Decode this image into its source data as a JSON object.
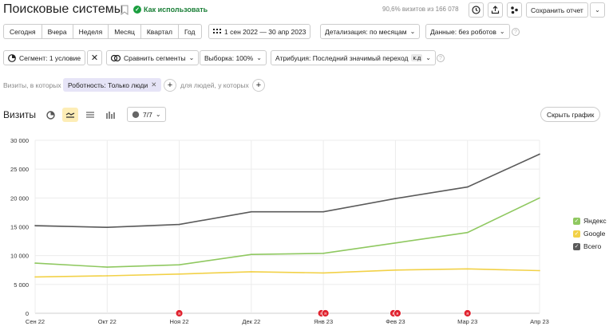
{
  "header": {
    "title": "Поисковые системы",
    "how_to_use": "Как использовать",
    "share_text": "90,6% визитов из 166 078",
    "save_report": "Сохранить отчет"
  },
  "toolbar": {
    "periods": [
      "Сегодня",
      "Вчера",
      "Неделя",
      "Месяц",
      "Квартал",
      "Год"
    ],
    "date_range": "1 сен 2022 — 30 апр 2023",
    "detail": "Детализация: по месяцам",
    "data": "Данные: без роботов"
  },
  "filters": {
    "segment": "Сегмент: 1 условие",
    "compare": "Сравнить сегменты",
    "sample": "Выборка: 100%",
    "attribution": "Атрибуция: Последний значимый переход",
    "attribution_badge": "к.д"
  },
  "conditions": {
    "visits_label": "Визиты, в которых",
    "chip": "Роботность: Только люди",
    "people_label": "для людей, у которых"
  },
  "chart_header": {
    "metric": "Визиты",
    "series_count": "7/7",
    "hide_chart": "Скрыть график"
  },
  "colors": {
    "yandex": "#8fc860",
    "google": "#f2d147",
    "total": "#5a5a5a",
    "marker": "#e0232f"
  },
  "chart_data": {
    "type": "line",
    "categories": [
      "Сен 22",
      "Окт 22",
      "Ноя 22",
      "Дек 22",
      "Янв 23",
      "Фев 23",
      "Мар 23",
      "Апр 23"
    ],
    "ylim": [
      0,
      30000
    ],
    "yticks": [
      "0",
      "5 000",
      "10 000",
      "15 000",
      "20 000",
      "25 000",
      "30 000"
    ],
    "grid": true,
    "legend": "right",
    "series": [
      {
        "name": "Яндекс",
        "color": "#8fc860",
        "values": [
          8700,
          8000,
          8400,
          10200,
          10400,
          12200,
          14000,
          20000
        ]
      },
      {
        "name": "Google",
        "color": "#f2d147",
        "values": [
          6300,
          6500,
          6800,
          7200,
          7000,
          7500,
          7700,
          7400
        ]
      },
      {
        "name": "Всего",
        "color": "#5a5a5a",
        "values": [
          15200,
          14900,
          15400,
          17600,
          17600,
          19900,
          21900,
          27600
        ]
      }
    ],
    "annotations": [
      {
        "category": "Ноя 22",
        "count": 1,
        "label": "я"
      },
      {
        "category": "Янв 23",
        "count": 2,
        "label": "я"
      },
      {
        "category": "Фев 23",
        "count": 2,
        "label": "я"
      },
      {
        "category": "Мар 23",
        "count": 1,
        "label": "я"
      }
    ]
  }
}
